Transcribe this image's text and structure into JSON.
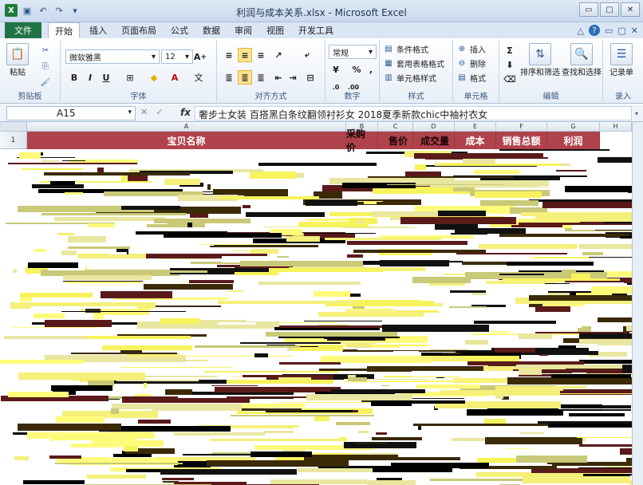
{
  "window": {
    "title": "利润与成本关系.xlsx - Microsoft Excel",
    "app_icon_label": "X",
    "controls": [
      "minimize-icon",
      "maximize-icon",
      "close-icon"
    ],
    "control_glyphs": [
      "▭",
      "▢",
      "✕"
    ]
  },
  "tabs": {
    "file": "文件",
    "items": [
      "开始",
      "插入",
      "页面布局",
      "公式",
      "数据",
      "审阅",
      "视图",
      "开发工具"
    ],
    "active_index": 0
  },
  "ribbon": {
    "clipboard": {
      "label": "剪贴板",
      "paste": "粘贴"
    },
    "font": {
      "label": "字体",
      "name": "微软雅黑",
      "size": "12",
      "bold": "B",
      "italic": "I",
      "underline": "U",
      "wen": "文"
    },
    "alignment": {
      "label": "对齐方式"
    },
    "number": {
      "label": "数字",
      "format": "常规",
      "percent": "%",
      "comma": ","
    },
    "styles": {
      "label": "样式",
      "conditional": "条件格式",
      "table": "套用表格格式",
      "cell": "单元格样式"
    },
    "cells": {
      "label": "单元格",
      "insert": "插入",
      "delete": "删除",
      "format": "格式"
    },
    "editing": {
      "label": "编辑",
      "sigma": "Σ",
      "sort": "排序和筛选",
      "find": "查找和选择"
    },
    "record": {
      "label": "录入",
      "sheet": "记录单"
    }
  },
  "formula_bar": {
    "cell_ref": "A15",
    "fx": "fx",
    "content": "奢步士女装 百搭黑白条纹翻领衬衫女 2018夏季新款chic中袖衬衣女"
  },
  "sheet": {
    "columns": [
      "A",
      "B",
      "C",
      "D",
      "E",
      "F",
      "G",
      "H"
    ],
    "row_numbers": [
      "1"
    ],
    "header_row": [
      "宝贝名称",
      "采购价",
      "售价",
      "成交量",
      "成本",
      "销售总额",
      "利润"
    ],
    "accent_color": "#b0424b"
  }
}
